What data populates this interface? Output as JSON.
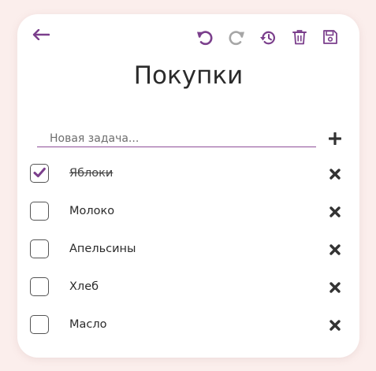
{
  "header": {
    "title": "Покупки"
  },
  "toolbar": {
    "icons": [
      "back-arrow-icon",
      "undo-icon",
      "redo-icon",
      "history-icon",
      "trash-icon",
      "save-icon"
    ],
    "redo_enabled": false
  },
  "new_task": {
    "placeholder": "Новая задача...",
    "value": ""
  },
  "tasks": [
    {
      "label": "Яблоки",
      "done": true
    },
    {
      "label": "Молоко",
      "done": false
    },
    {
      "label": "Апельсины",
      "done": false
    },
    {
      "label": "Хлеб",
      "done": false
    },
    {
      "label": "Масло",
      "done": false
    }
  ],
  "colors": {
    "accent": "#7b3f8c",
    "disabled": "#a6a6a6",
    "background": "#fbeeec",
    "card": "#ffffff",
    "text": "#2b2b2b"
  }
}
